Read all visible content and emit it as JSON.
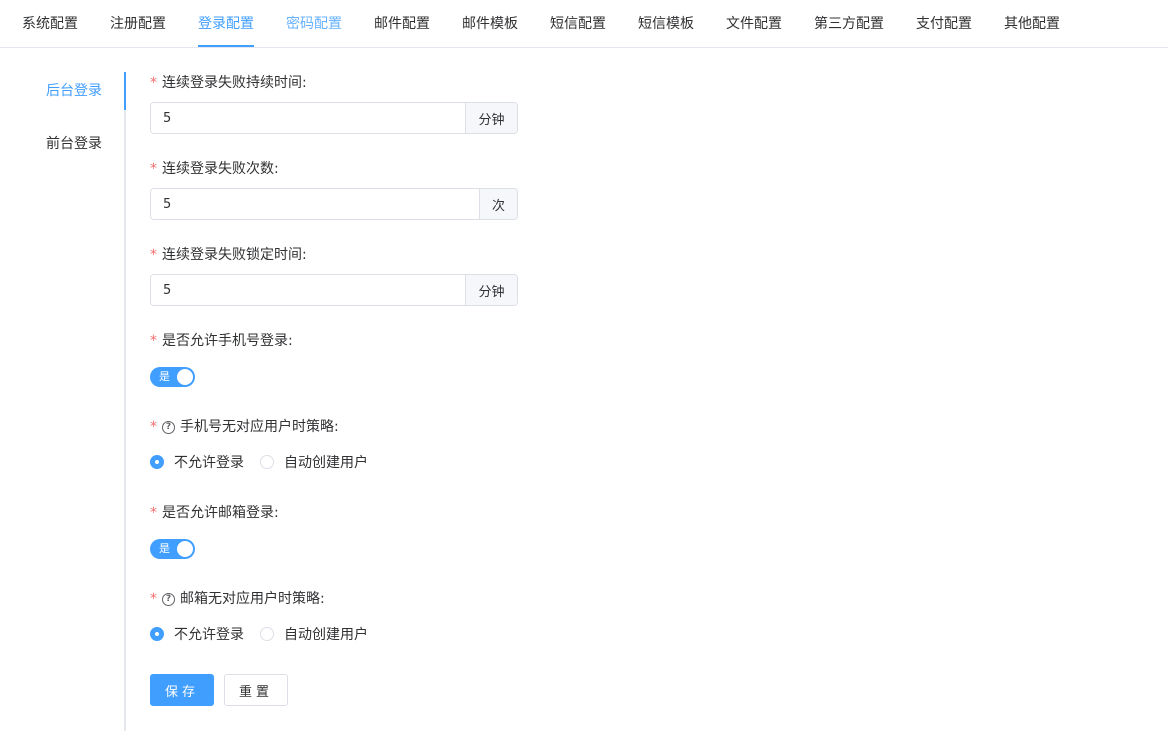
{
  "top_tabs": [
    {
      "label": "系统配置"
    },
    {
      "label": "注册配置"
    },
    {
      "label": "登录配置"
    },
    {
      "label": "密码配置"
    },
    {
      "label": "邮件配置"
    },
    {
      "label": "邮件模板"
    },
    {
      "label": "短信配置"
    },
    {
      "label": "短信模板"
    },
    {
      "label": "文件配置"
    },
    {
      "label": "第三方配置"
    },
    {
      "label": "支付配置"
    },
    {
      "label": "其他配置"
    }
  ],
  "active_top_tab": "登录配置",
  "side_tabs": [
    {
      "label": "后台登录"
    },
    {
      "label": "前台登录"
    }
  ],
  "active_side_tab": "后台登录",
  "form": {
    "required_mark": "*",
    "fail_duration": {
      "label": "连续登录失败持续时间:",
      "value": "5",
      "unit": "分钟"
    },
    "fail_count": {
      "label": "连续登录失败次数:",
      "value": "5",
      "unit": "次"
    },
    "lock_time": {
      "label": "连续登录失败锁定时间:",
      "value": "5",
      "unit": "分钟"
    },
    "allow_phone": {
      "label": "是否允许手机号登录:",
      "switch_text": "是",
      "on": true
    },
    "phone_strategy": {
      "help_icon": "?",
      "label": "手机号无对应用户时策略:",
      "options": [
        "不允许登录",
        "自动创建用户"
      ],
      "selected": "不允许登录"
    },
    "allow_email": {
      "label": "是否允许邮箱登录:",
      "switch_text": "是",
      "on": true
    },
    "email_strategy": {
      "help_icon": "?",
      "label": "邮箱无对应用户时策略:",
      "options": [
        "不允许登录",
        "自动创建用户"
      ],
      "selected": "不允许登录"
    },
    "save_label": "保存",
    "reset_label": "重置"
  },
  "colors": {
    "accent": "#409eff",
    "required": "#f56c6c",
    "border": "#dcdfe6"
  }
}
